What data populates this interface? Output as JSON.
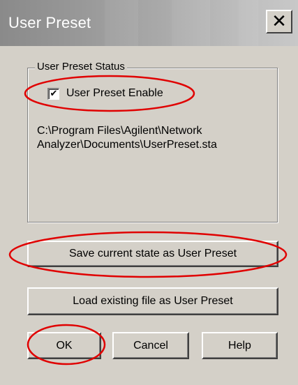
{
  "window": {
    "title": "User Preset",
    "close_icon": "close-icon",
    "close_glyph": "✕"
  },
  "group": {
    "legend": "User Preset Status",
    "checkbox_label": "User Preset Enable",
    "checkbox_checked": true,
    "checkbox_glyph": "✔",
    "file_path": "C:\\Program Files\\Agilent\\Network Analyzer\\Documents\\UserPreset.sta"
  },
  "buttons": {
    "save": "Save current state as User Preset",
    "load": "Load existing file as User Preset",
    "ok": "OK",
    "cancel": "Cancel",
    "help": "Help"
  },
  "colors": {
    "dialog_bg": "#d4d0c8",
    "annotation": "#e00000"
  }
}
